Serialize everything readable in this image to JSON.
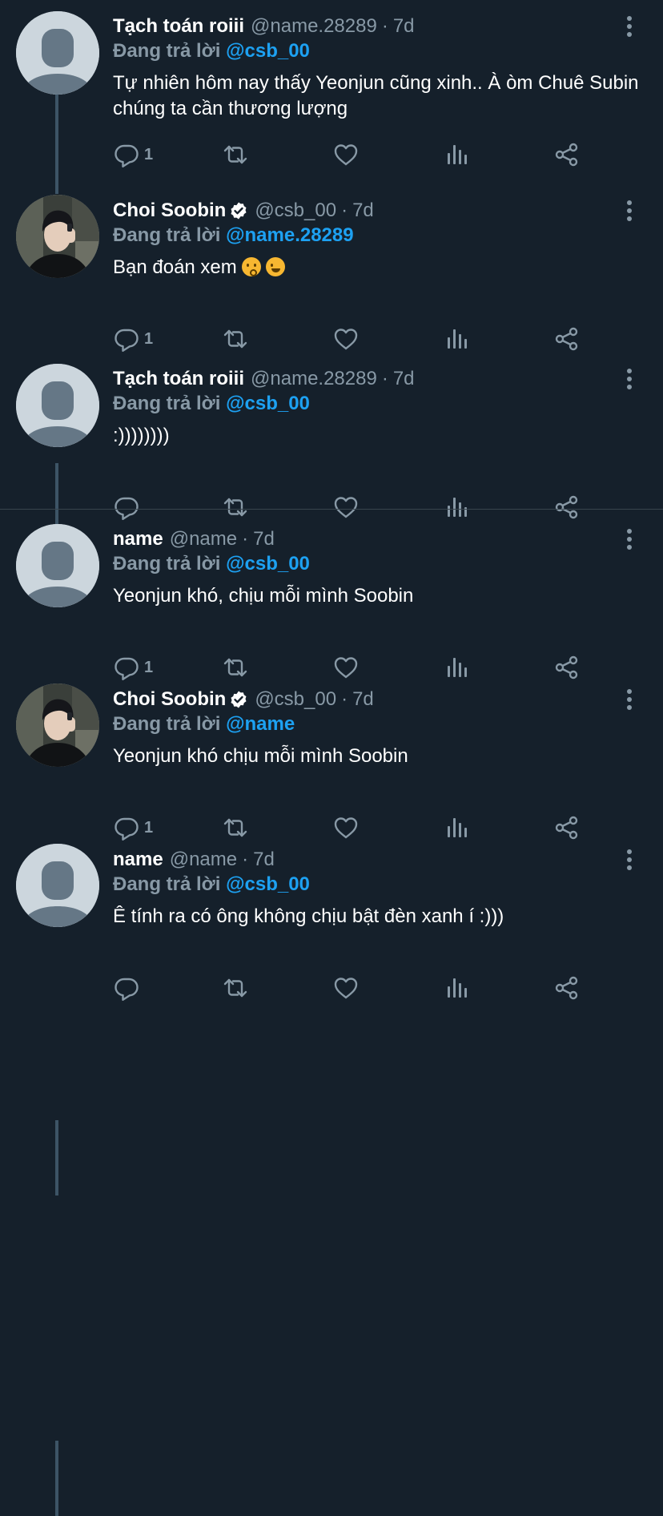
{
  "tweets": [
    {
      "display_name": "Tạch toán roiii",
      "handle": "@name.28289",
      "time": "7d",
      "verified": false,
      "avatar": "default-avatar-icon",
      "replying_prefix": "Đang trả lời",
      "replying_to": "@csb_00",
      "text": "Tự nhiên hôm nay thấy Yeonjun cũng xinh.. À òm Chuê Subin chúng ta cần thương lượng",
      "reply_count": "1"
    },
    {
      "display_name": "Choi Soobin",
      "handle": "@csb_00",
      "time": "7d",
      "verified": true,
      "avatar": "profile-photo",
      "replying_prefix": "Đang trả lời",
      "replying_to": "@name.28289",
      "text": "Bạn đoán xem",
      "emojis": [
        "kissing-face",
        "winking-face"
      ],
      "reply_count": "1"
    },
    {
      "display_name": "Tạch toán roiii",
      "handle": "@name.28289",
      "time": "7d",
      "verified": false,
      "avatar": "default-avatar-icon",
      "replying_prefix": "Đang trả lời",
      "replying_to": "@csb_00",
      "text": ":))))))))",
      "reply_count": ""
    },
    {
      "display_name": "name",
      "handle": "@name",
      "time": "7d",
      "verified": false,
      "avatar": "default-avatar-icon",
      "replying_prefix": "Đang trả lời",
      "replying_to": "@csb_00",
      "text": "Yeonjun khó, chịu mỗi mình Soobin",
      "reply_count": "1"
    },
    {
      "display_name": "Choi Soobin",
      "handle": "@csb_00",
      "time": "7d",
      "verified": true,
      "avatar": "profile-photo",
      "replying_prefix": "Đang trả lời",
      "replying_to": "@name",
      "text": "Yeonjun khó chịu mỗi mình Soobin",
      "reply_count": "1"
    },
    {
      "display_name": "name",
      "handle": "@name",
      "time": "7d",
      "verified": false,
      "avatar": "default-avatar-icon",
      "replying_prefix": "Đang trả lời",
      "replying_to": "@csb_00",
      "text": "Ê tính ra có ông không chịu bật đèn xanh í :)))",
      "reply_count": ""
    }
  ],
  "action_icons": [
    "reply-icon",
    "retweet-icon",
    "like-icon",
    "analytics-icon",
    "share-icon"
  ],
  "colors": {
    "background": "#15202b",
    "text": "#ffffff",
    "muted": "#8899a6",
    "mention": "#1da1f2",
    "thread_line": "#3d5466",
    "divider": "#38444d",
    "avatar_bg": "#ccd6dd",
    "avatar_fg": "#657786"
  }
}
